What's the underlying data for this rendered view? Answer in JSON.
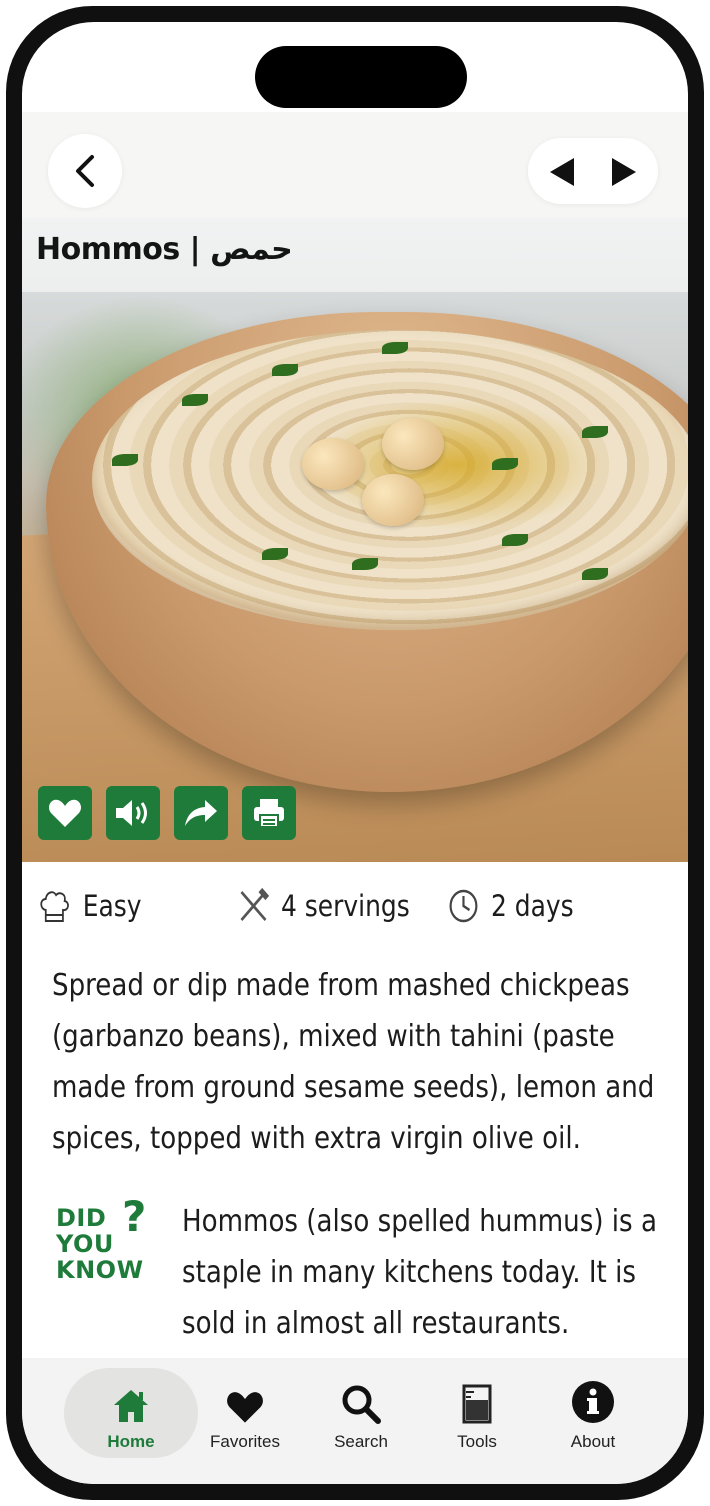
{
  "header": {
    "title": "Hommos | حمص"
  },
  "recipe": {
    "difficulty": "Easy",
    "servings": "4 servings",
    "time": "2 days",
    "description": "Spread or dip made from mashed chickpeas (garbanzo beans), mixed with tahini (paste made from ground sesame seeds), lemon and spices, topped with extra virgin olive oil.",
    "did_you_know": {
      "badge_line1": "DID",
      "badge_line2": "YOU",
      "badge_line3": "KNOW",
      "badge_mark": "?",
      "text": "Hommos (also spelled hummus) is a staple in many kitchens today. It is sold in almost all restaurants."
    }
  },
  "actions": [
    "heart-icon",
    "speaker-icon",
    "share-icon",
    "print-icon"
  ],
  "tabs": [
    {
      "label": "Home",
      "icon": "home-icon",
      "active": true
    },
    {
      "label": "Favorites",
      "icon": "heart-icon",
      "active": false
    },
    {
      "label": "Search",
      "icon": "search-icon",
      "active": false
    },
    {
      "label": "Tools",
      "icon": "measuring-cup-icon",
      "active": false
    },
    {
      "label": "About",
      "icon": "info-icon",
      "active": false
    }
  ],
  "colors": {
    "accent": "#1e7b3a",
    "tabbar_bg": "#f3f3f3",
    "text": "#1c1c1c"
  }
}
